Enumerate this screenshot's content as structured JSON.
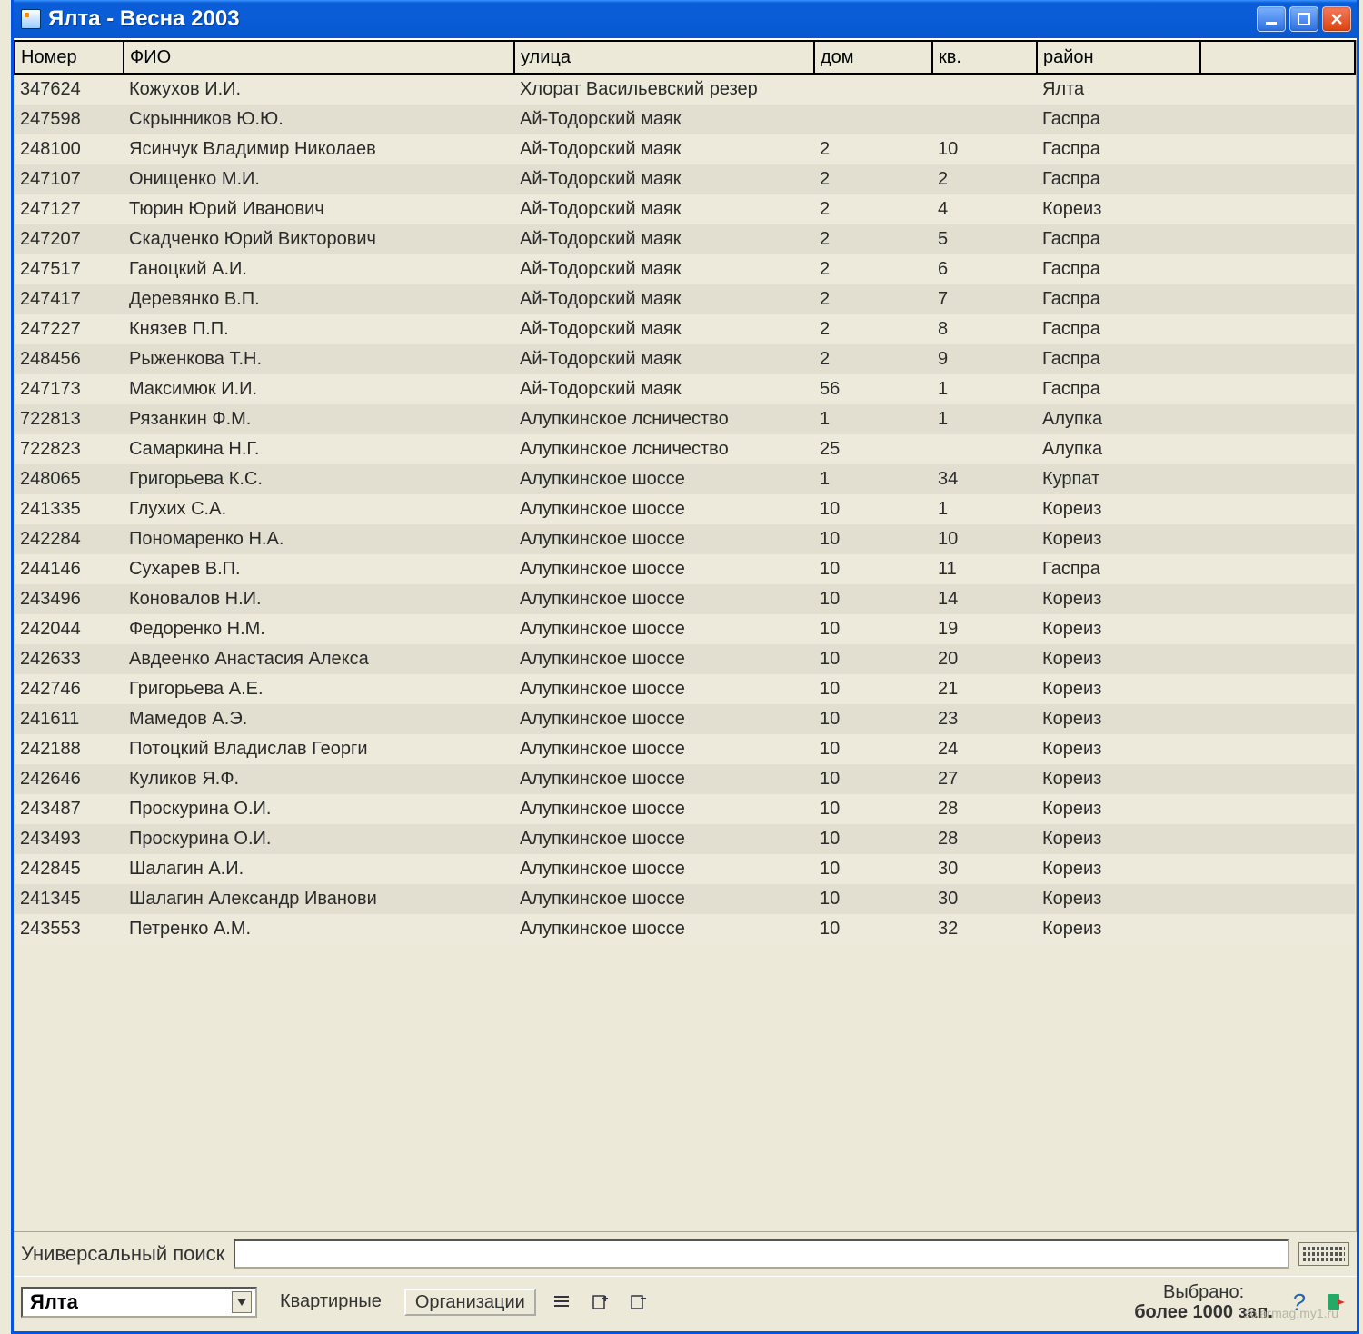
{
  "window": {
    "title": "Ялта  - Весна 2003"
  },
  "columns": {
    "num": "Номер",
    "fio": "ФИО",
    "street": "улица",
    "house": "дом",
    "apt": "кв.",
    "raion": "район"
  },
  "rows": [
    {
      "num": "347624",
      "fio": "Кожухов И.И.",
      "street": " Хлорат Васильевский резер",
      "house": "",
      "apt": "",
      "raion": "Ялта"
    },
    {
      "num": "247598",
      "fio": "Скрынников Ю.Ю.",
      "street": "Ай-Тодорский маяк",
      "house": "",
      "apt": "",
      "raion": "Гаспра"
    },
    {
      "num": "248100",
      "fio": "Ясинчук Владимир Николаев",
      "street": "Ай-Тодорский маяк",
      "house": "2",
      "apt": "10",
      "raion": "Гаспра"
    },
    {
      "num": "247107",
      "fio": "Онищенко М.И.",
      "street": "Ай-Тодорский маяк",
      "house": "2",
      "apt": "2",
      "raion": "Гаспра"
    },
    {
      "num": "247127",
      "fio": "Тюрин Юрий Иванович",
      "street": "Ай-Тодорский маяк",
      "house": "2",
      "apt": "4",
      "raion": "Кореиз"
    },
    {
      "num": "247207",
      "fio": "Скадченко Юрий Викторович",
      "street": "Ай-Тодорский маяк",
      "house": "2",
      "apt": "5",
      "raion": "Гаспра"
    },
    {
      "num": "247517",
      "fio": "Ганоцкий А.И.",
      "street": "Ай-Тодорский маяк",
      "house": "2",
      "apt": "6",
      "raion": "Гаспра"
    },
    {
      "num": "247417",
      "fio": "Деревянко В.П.",
      "street": "Ай-Тодорский маяк",
      "house": "2",
      "apt": "7",
      "raion": "Гаспра"
    },
    {
      "num": "247227",
      "fio": "Князев П.П.",
      "street": "Ай-Тодорский маяк",
      "house": "2",
      "apt": "8",
      "raion": "Гаспра"
    },
    {
      "num": "248456",
      "fio": "Рыженкова Т.Н.",
      "street": "Ай-Тодорский маяк",
      "house": "2",
      "apt": "9",
      "raion": "Гаспра"
    },
    {
      "num": "247173",
      "fio": "Максимюк И.И.",
      "street": "Ай-Тодорский маяк",
      "house": "56",
      "apt": "1",
      "raion": "Гаспра"
    },
    {
      "num": "722813",
      "fio": "Рязанкин Ф.М.",
      "street": "Алупкинское лсничество",
      "house": "1",
      "apt": "1",
      "raion": "Алупка"
    },
    {
      "num": "722823",
      "fio": "Самаркина Н.Г.",
      "street": "Алупкинское лсничество",
      "house": "25",
      "apt": "",
      "raion": "Алупка"
    },
    {
      "num": "248065",
      "fio": "Григорьева К.С.",
      "street": "Алупкинское шоссе",
      "house": "1",
      "apt": "34",
      "raion": "Курпат"
    },
    {
      "num": "241335",
      "fio": "Глухих С.А.",
      "street": "Алупкинское шоссе",
      "house": "10",
      "apt": "1",
      "raion": "Кореиз"
    },
    {
      "num": "242284",
      "fio": "Пономаренко Н.А.",
      "street": "Алупкинское шоссе",
      "house": "10",
      "apt": "10",
      "raion": "Кореиз"
    },
    {
      "num": "244146",
      "fio": "Сухарев В.П.",
      "street": "Алупкинское шоссе",
      "house": "10",
      "apt": "11",
      "raion": "Гаспра"
    },
    {
      "num": "243496",
      "fio": "Коновалов Н.И.",
      "street": "Алупкинское шоссе",
      "house": "10",
      "apt": "14",
      "raion": "Кореиз"
    },
    {
      "num": "242044",
      "fio": "Федоренко Н.М.",
      "street": "Алупкинское шоссе",
      "house": "10",
      "apt": "19",
      "raion": "Кореиз"
    },
    {
      "num": "242633",
      "fio": "Авдеенко Анастасия Алекса",
      "street": "Алупкинское шоссе",
      "house": "10",
      "apt": "20",
      "raion": "Кореиз"
    },
    {
      "num": "242746",
      "fio": "Григорьева А.Е.",
      "street": "Алупкинское шоссе",
      "house": "10",
      "apt": "21",
      "raion": "Кореиз"
    },
    {
      "num": "241611",
      "fio": "Мамедов А.Э.",
      "street": "Алупкинское шоссе",
      "house": "10",
      "apt": "23",
      "raion": "Кореиз"
    },
    {
      "num": "242188",
      "fio": "Потоцкий Владислав Георги",
      "street": "Алупкинское шоссе",
      "house": "10",
      "apt": "24",
      "raion": "Кореиз"
    },
    {
      "num": "242646",
      "fio": "Куликов Я.Ф.",
      "street": "Алупкинское шоссе",
      "house": "10",
      "apt": "27",
      "raion": "Кореиз"
    },
    {
      "num": "243487",
      "fio": "Проскурина О.И.",
      "street": "Алупкинское шоссе",
      "house": "10",
      "apt": "28",
      "raion": "Кореиз"
    },
    {
      "num": "243493",
      "fio": "Проскурина О.И.",
      "street": "Алупкинское шоссе",
      "house": "10",
      "apt": "28",
      "raion": "Кореиз"
    },
    {
      "num": "242845",
      "fio": "Шалагин А.И.",
      "street": "Алупкинское шоссе",
      "house": "10",
      "apt": "30",
      "raion": "Кореиз"
    },
    {
      "num": "241345",
      "fio": "Шалагин Александр Иванови",
      "street": "Алупкинское шоссе",
      "house": "10",
      "apt": "30",
      "raion": "Кореиз"
    },
    {
      "num": "243553",
      "fio": "Петренко А.М.",
      "street": "Алупкинское шоссе",
      "house": "10",
      "apt": "32",
      "raion": "Кореиз"
    }
  ],
  "search": {
    "label": "Универсальный поиск",
    "value": ""
  },
  "toolbar": {
    "dropdown_value": "Ялта",
    "btn_kvartirnye": "Квартирные",
    "btn_organizacii": "Организации"
  },
  "status": {
    "line1": "Выбрано:",
    "line2": "более 1000 зап."
  },
  "watermark": "solarmag.my1.ru"
}
